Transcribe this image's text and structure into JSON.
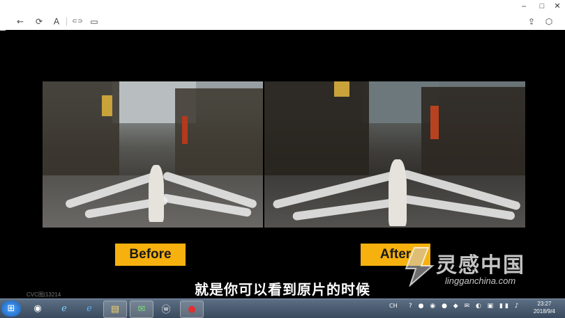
{
  "window": {
    "controls": {
      "minimize": "–",
      "maximize": "□",
      "close": "✕"
    }
  },
  "toolbar": {
    "back_icon": "←",
    "refresh_icon": "⟳",
    "text_icon": "A",
    "link_icon": "⊂⊃",
    "window_icon": "▭",
    "share_icon": "⇪",
    "box_icon": "⬡"
  },
  "video": {
    "before_label": "Before",
    "after_label": "After",
    "subtitle": "就是你可以看到原片的时候",
    "small_watermark": "CVC图|13214"
  },
  "watermark": {
    "chinese": "灵感中国",
    "english": "lingganchina.com"
  },
  "taskbar": {
    "start": "⊞",
    "apps": [
      "◉",
      "ℯ",
      "ℯ",
      "▤",
      "✉",
      "ⓦ",
      "●"
    ],
    "tray": "CH",
    "time": "23:27",
    "date": "2018/9/4"
  }
}
